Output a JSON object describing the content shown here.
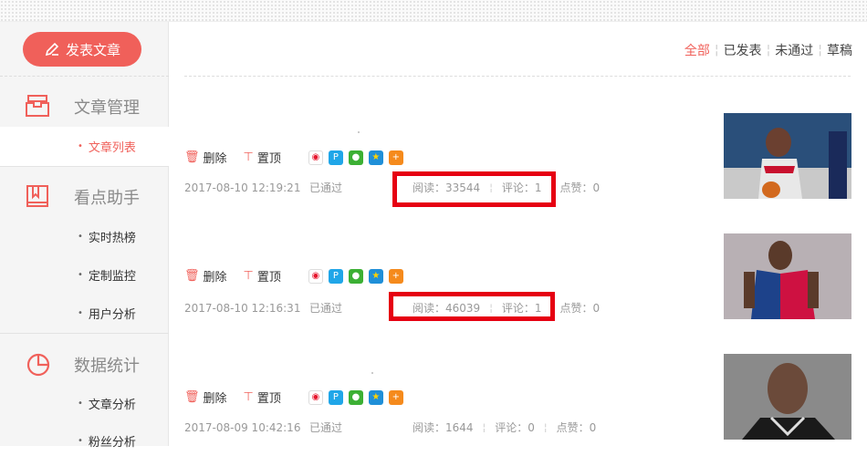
{
  "sidebar": {
    "publish_label": "发表文章",
    "sections": [
      {
        "title": "文章管理",
        "icon": "inbox-icon",
        "items": [
          {
            "label": "文章列表",
            "active": true
          }
        ]
      },
      {
        "title": "看点助手",
        "icon": "book-icon",
        "items": [
          {
            "label": "实时热榜"
          },
          {
            "label": "定制监控"
          },
          {
            "label": "用户分析"
          }
        ]
      },
      {
        "title": "数据统计",
        "icon": "pie-chart-icon",
        "items": [
          {
            "label": "文章分析"
          },
          {
            "label": "粉丝分析"
          }
        ]
      }
    ]
  },
  "filters": [
    "全部",
    "已发表",
    "未通过",
    "草稿"
  ],
  "filters_active": "全部",
  "actions": {
    "delete": "删除",
    "pin": "置顶"
  },
  "share_icons": [
    "weibo-icon",
    "qq-zone-icon",
    "wechat-icon",
    "qq-icon",
    "plus-icon"
  ],
  "accent_color": "#f0605a",
  "highlight_color": "#e60012",
  "articles": [
    {
      "date": "2017-08-10 12:19:21",
      "status": "已通过",
      "reads": "阅读：33544",
      "comments": "评论：1",
      "likes": "点赞：0",
      "image": "basketball-player-red-jersey",
      "highlighted": true
    },
    {
      "date": "2017-08-10 12:16:31",
      "status": "已通过",
      "reads": "阅读：46039",
      "comments": "评论：1",
      "likes": "点赞：0",
      "image": "basketball-player-rockets-jersey",
      "highlighted": true
    },
    {
      "date": "2017-08-09 10:42:16",
      "status": "已通过",
      "reads": "阅读：1644",
      "comments": "评论：0",
      "likes": "点赞：0",
      "image": "basketball-player-portrait",
      "highlighted": false
    }
  ]
}
